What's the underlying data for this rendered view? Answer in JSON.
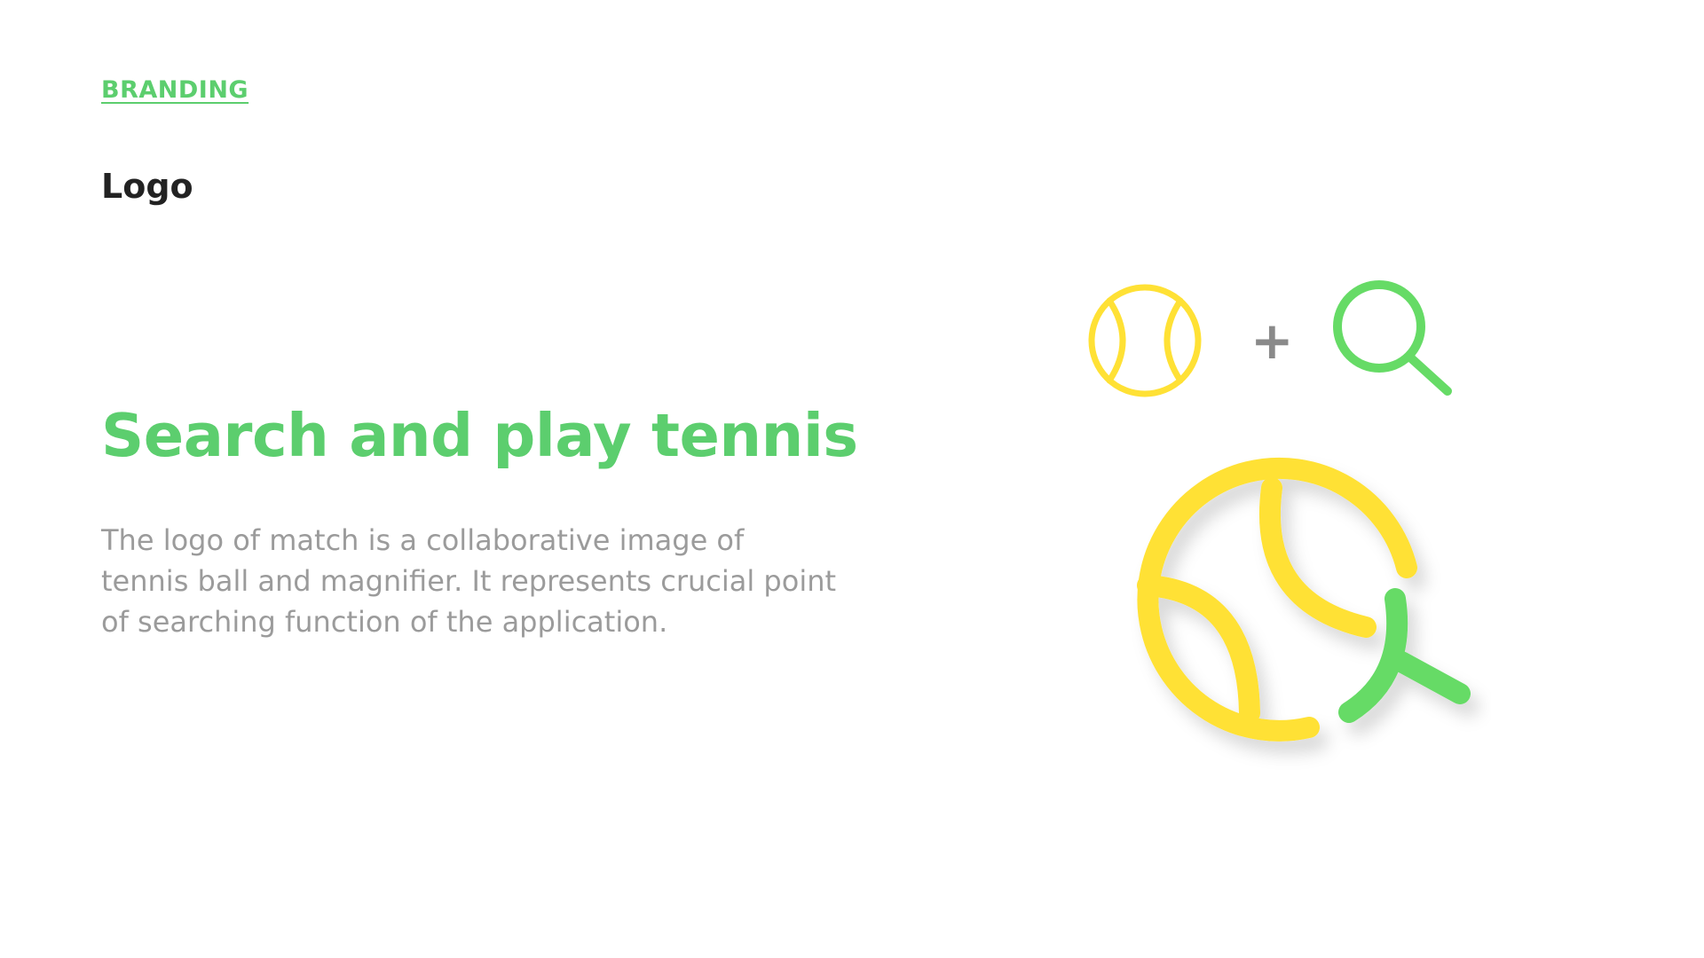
{
  "colors": {
    "accent_green": "#5cce6e",
    "logo_green": "#66db66",
    "logo_yellow": "#ffe135",
    "text_dark": "#222222",
    "text_gray": "#9b9b9b",
    "plus_gray": "#8a8a8a"
  },
  "header": {
    "section_label": "BRANDING",
    "subtitle": "Logo"
  },
  "main": {
    "headline": "Search and play tennis",
    "description_lines": [
      "The logo of match is a collaborative image of",
      "tennis ball and magnifier. It represents crucial point",
      "of searching function of the application."
    ]
  },
  "logo_composition": {
    "plus": "+",
    "icons": [
      "tennis-ball-icon",
      "magnifier-icon",
      "combined-logo-icon"
    ]
  }
}
